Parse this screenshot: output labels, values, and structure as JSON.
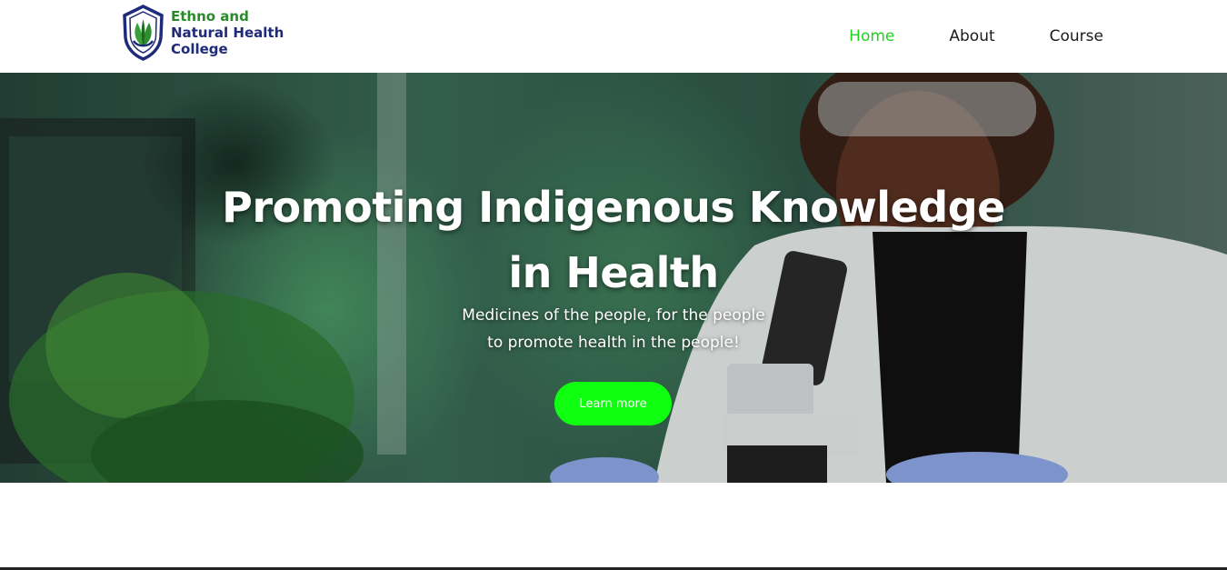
{
  "brand": {
    "line1": "Ethno and",
    "line2": "Natural Health",
    "line3": "College"
  },
  "nav": {
    "items": [
      {
        "label": "Home",
        "active": true
      },
      {
        "label": "About",
        "active": false
      },
      {
        "label": "Course",
        "active": false
      }
    ]
  },
  "hero": {
    "title_line1": "Promoting Indigenous Knowledge",
    "title_line2": "in Health",
    "subtitle_line1": "Medicines of the people, for the people",
    "subtitle_line2": "to promote health in the people!",
    "button_label": "Learn more"
  },
  "colors": {
    "accent_green": "#10ff10",
    "nav_active": "#1fd11f",
    "brand_green": "#2a8a2a",
    "brand_navy": "#1f2a7a"
  },
  "icons": {
    "logo": "shield-leaf-logo-icon"
  }
}
